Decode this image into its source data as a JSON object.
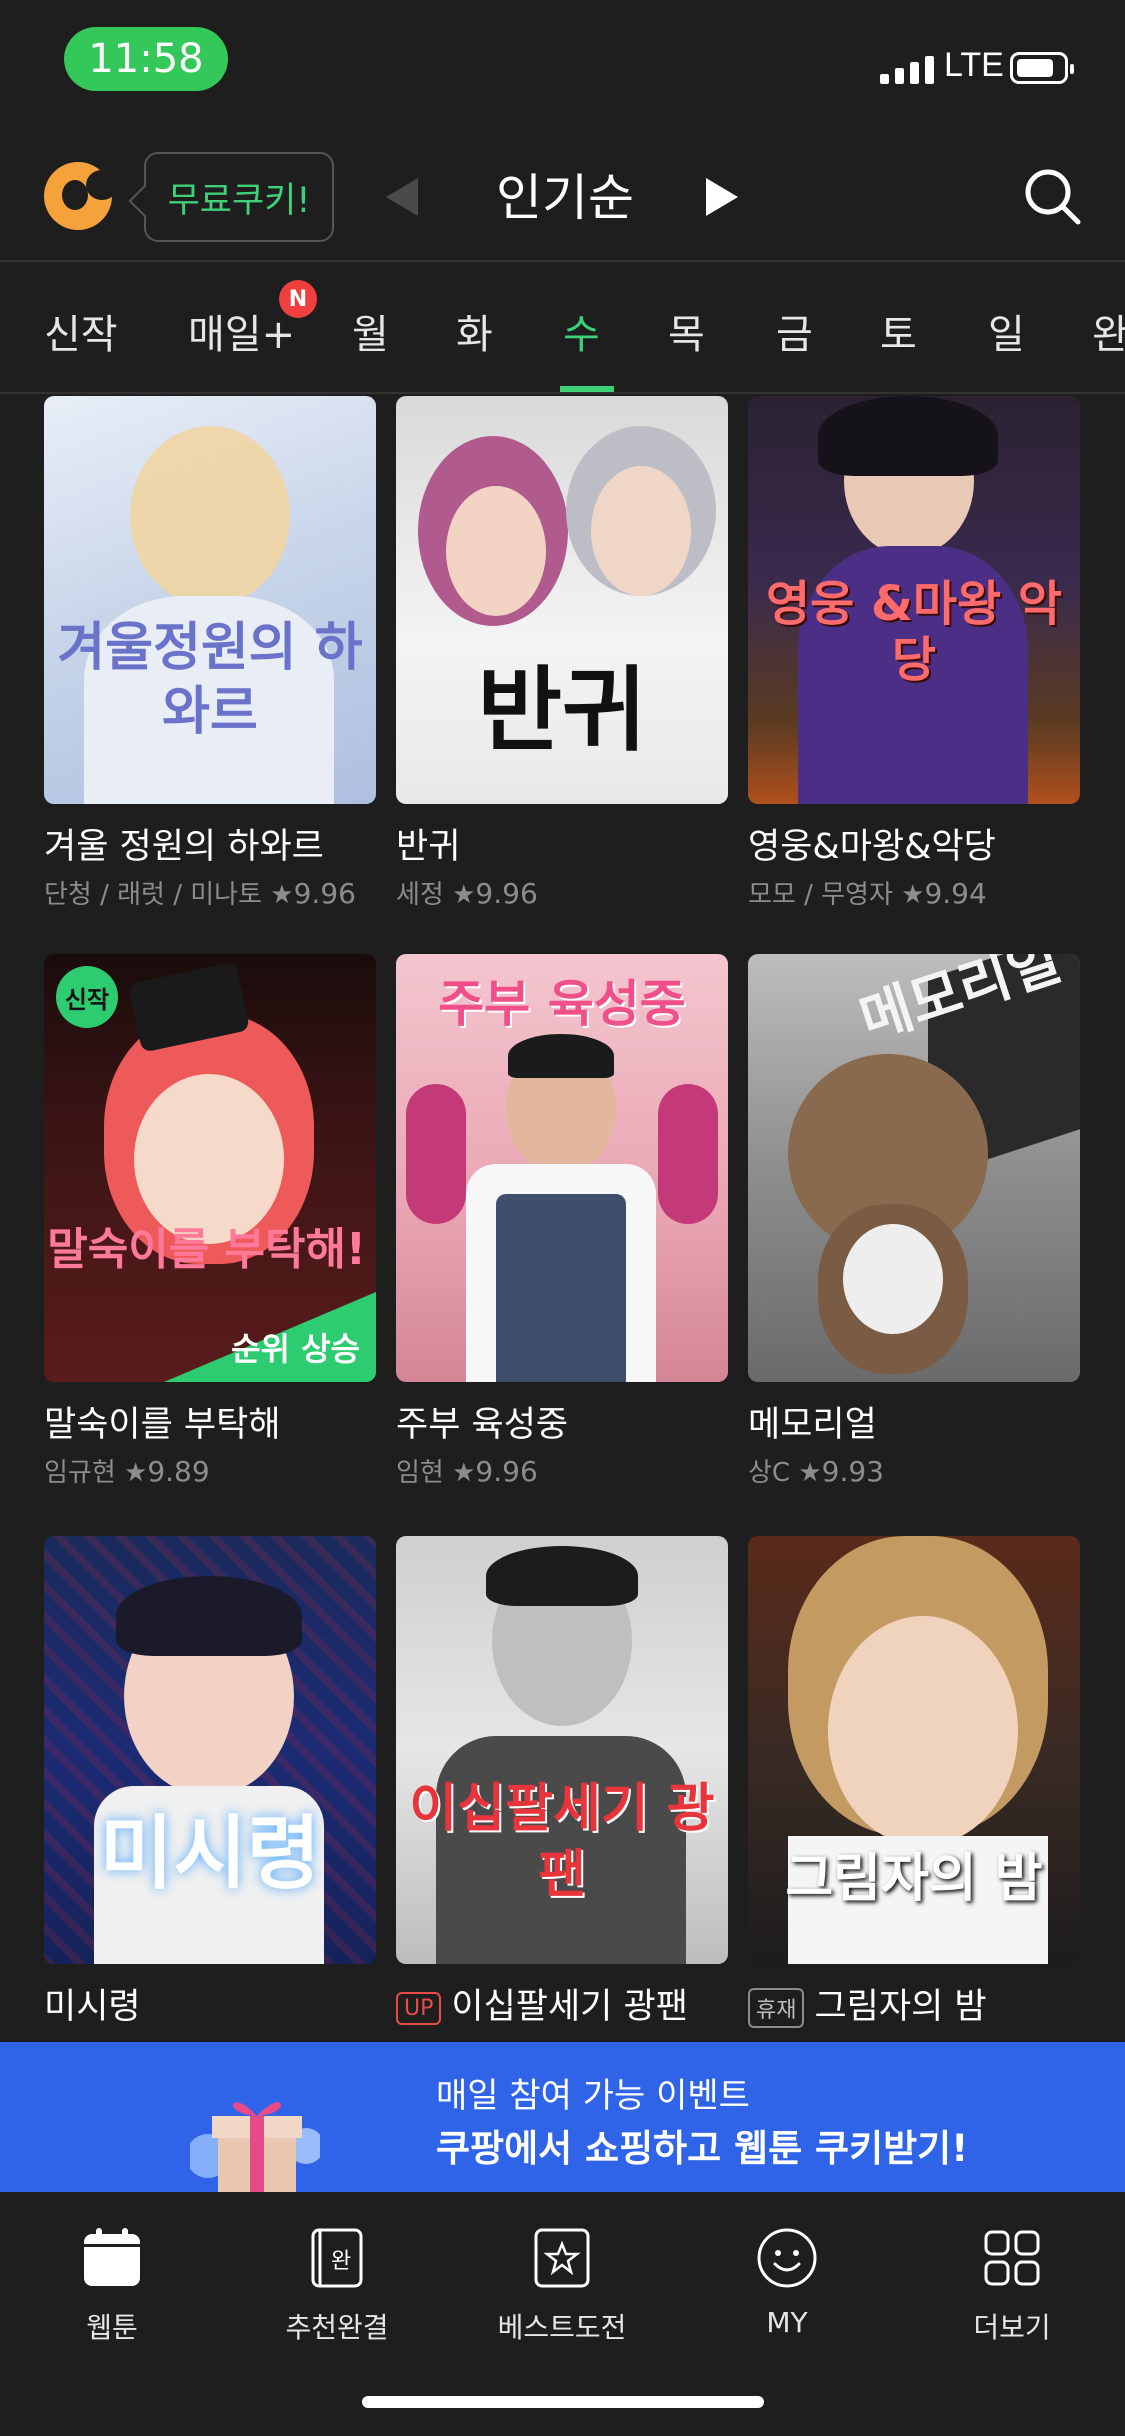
{
  "status_bar": {
    "time": "11:58",
    "network": "LTE"
  },
  "header": {
    "free_cookie_label": "무료쿠키!",
    "sort_title": "인기순"
  },
  "tabs": [
    {
      "label": "신작"
    },
    {
      "label": "매일+"
    },
    {
      "label": "월"
    },
    {
      "label": "화"
    },
    {
      "label": "수"
    },
    {
      "label": "목"
    },
    {
      "label": "금"
    },
    {
      "label": "토"
    },
    {
      "label": "일"
    },
    {
      "label": "완"
    }
  ],
  "active_tab": "수",
  "new_badge": "N",
  "webtoons": [
    {
      "cover_text": "겨울정원의 하와르",
      "title": "겨울 정원의 하와르",
      "authors": "단청 / 래럿 / 미나토",
      "score": "9.96"
    },
    {
      "cover_text": "반귀",
      "title": "반귀",
      "authors": "세정",
      "score": "9.96"
    },
    {
      "cover_text": "영웅 &마왕 악당",
      "title": "영웅&마왕&악당",
      "authors": "모모 / 무영자",
      "score": "9.94"
    },
    {
      "cover_text": "말숙이를 부탁해!",
      "title": "말숙이를 부탁해",
      "authors": "임규현",
      "score": "9.89",
      "new_tag": "신작",
      "rank_label": "순위 상승"
    },
    {
      "cover_text": "주부 육성중",
      "title": "주부 육성중",
      "authors": "임현",
      "score": "9.96"
    },
    {
      "cover_text": "메모리얼",
      "title": "메모리얼",
      "authors": "상C",
      "score": "9.93"
    },
    {
      "cover_text": "미시령",
      "title": "미시령"
    },
    {
      "cover_text": "이십팔세기 광팬",
      "title": "이십팔세기 광팬",
      "badge": "UP"
    },
    {
      "cover_text": "그림자의 밤",
      "title": "그림자의 밤",
      "badge": "휴재"
    }
  ],
  "banner": {
    "line1": "매일 참여 가능 이벤트",
    "line2": "쿠팡에서 쇼핑하고 웹툰 쿠키받기!"
  },
  "bottom_nav": [
    {
      "label": "웹툰",
      "icon": "calendar-icon"
    },
    {
      "label": "추천완결",
      "icon": "book-complete-icon",
      "icon_text": "완"
    },
    {
      "label": "베스트도전",
      "icon": "star-book-icon"
    },
    {
      "label": "MY",
      "icon": "smiley-icon"
    },
    {
      "label": "더보기",
      "icon": "grid-icon"
    }
  ],
  "colors": {
    "accent": "#3ed178",
    "background": "#1e1e1e",
    "banner": "#2f63e8",
    "badge_red": "#ef3f3f"
  }
}
